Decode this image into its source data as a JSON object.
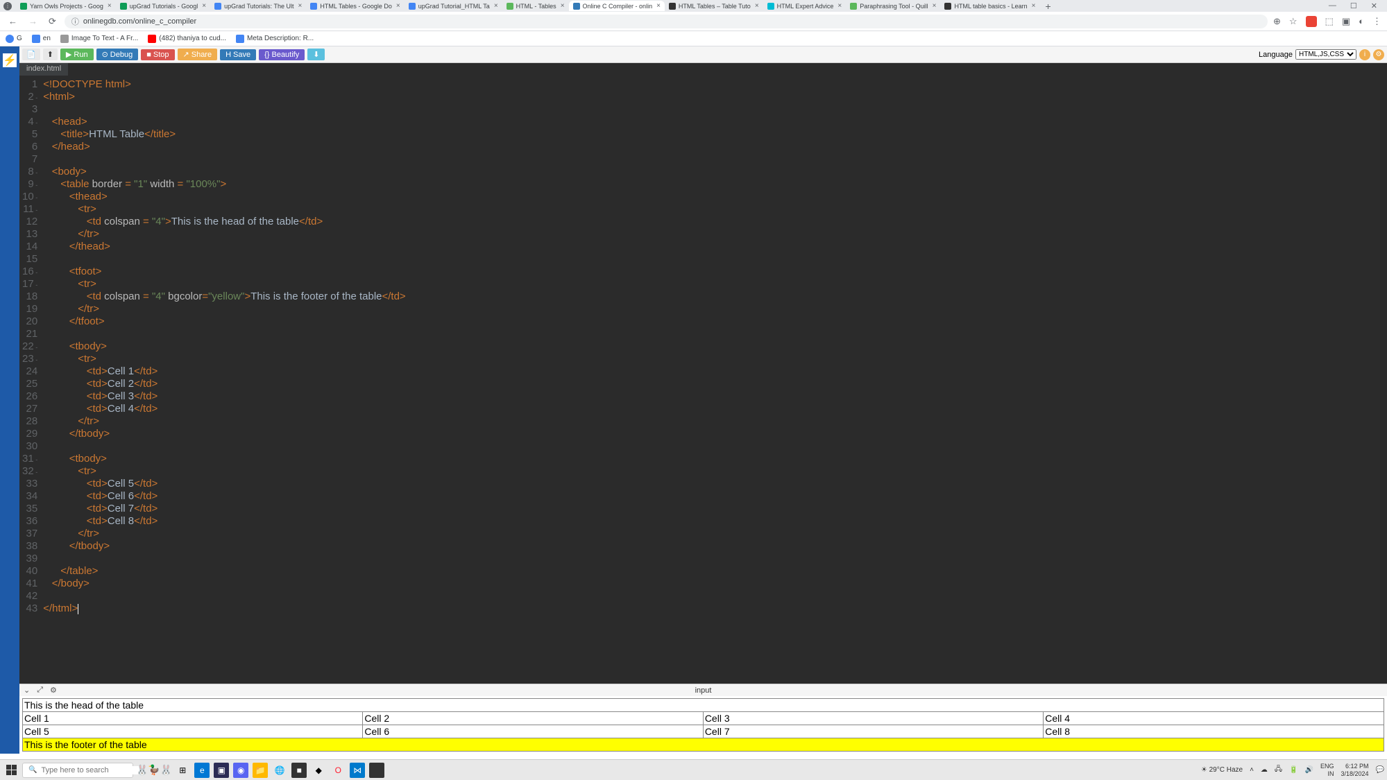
{
  "browser": {
    "tabs": [
      {
        "title": "Yarn Owls Projects - Goog",
        "favcolor": "#0f9d58"
      },
      {
        "title": "upGrad Tutorials - Googl",
        "favcolor": "#0f9d58"
      },
      {
        "title": "upGrad Tutorials: The Ult",
        "favcolor": "#4285f4"
      },
      {
        "title": "HTML Tables - Google Do",
        "favcolor": "#4285f4"
      },
      {
        "title": "upGrad Tutorial_HTML Ta",
        "favcolor": "#4285f4"
      },
      {
        "title": "HTML - Tables",
        "favcolor": "#5cb85c"
      },
      {
        "title": "Online C Compiler - onlin",
        "favcolor": "#337ab7",
        "active": true
      },
      {
        "title": "HTML Tables – Table Tuto",
        "favcolor": "#333"
      },
      {
        "title": "HTML Expert Advice",
        "favcolor": "#00bcd4"
      },
      {
        "title": "Paraphrasing Tool - Quill",
        "favcolor": "#5cb85c"
      },
      {
        "title": "HTML table basics - Learn",
        "favcolor": "#333"
      }
    ],
    "url": "onlinegdb.com/online_c_compiler",
    "bookmarks": [
      {
        "label": "en",
        "icon": "#4285f4"
      },
      {
        "label": "Image To Text - A Fr...",
        "icon": "#999"
      },
      {
        "label": "(482) thaniya to cud...",
        "icon": "#f00"
      },
      {
        "label": "Meta Description: R...",
        "icon": "#4285f4"
      }
    ]
  },
  "ide": {
    "toolbar": {
      "run": "Run",
      "debug": "Debug",
      "stop": "Stop",
      "share": "Share",
      "save": "Save",
      "beautify": "Beautify",
      "lang_label": "Language",
      "lang_value": "HTML,JS,CSS"
    },
    "file_tab": "index.html",
    "output_label": "input"
  },
  "code_lines": [
    {
      "n": 1,
      "html": "<span class='t-tag'>&lt;!DOCTYPE html&gt;</span>"
    },
    {
      "n": 2,
      "fold": true,
      "html": "<span class='t-tag'>&lt;html&gt;</span>"
    },
    {
      "n": 3,
      "html": ""
    },
    {
      "n": 4,
      "fold": true,
      "html": "   <span class='t-tag'>&lt;head&gt;</span>"
    },
    {
      "n": 5,
      "html": "      <span class='t-tag'>&lt;title&gt;</span><span class='t-text'>HTML Table</span><span class='t-tag'>&lt;/title&gt;</span>"
    },
    {
      "n": 6,
      "html": "   <span class='t-tag'>&lt;/head&gt;</span>"
    },
    {
      "n": 7,
      "html": ""
    },
    {
      "n": 8,
      "fold": true,
      "html": "   <span class='t-tag'>&lt;body&gt;</span>"
    },
    {
      "n": 9,
      "fold": true,
      "html": "      <span class='t-tag'>&lt;table</span> <span class='t-attr'>border</span> <span class='t-op'>=</span> <span class='t-str'>\"1\"</span> <span class='t-attr'>width</span> <span class='t-op'>=</span> <span class='t-str'>\"100%\"</span><span class='t-tag'>&gt;</span>"
    },
    {
      "n": 10,
      "fold": true,
      "html": "         <span class='t-tag'>&lt;thead&gt;</span>"
    },
    {
      "n": 11,
      "fold": true,
      "html": "            <span class='t-tag'>&lt;tr&gt;</span>"
    },
    {
      "n": 12,
      "html": "               <span class='t-tag'>&lt;td</span> <span class='t-attr'>colspan</span> <span class='t-op'>=</span> <span class='t-str'>\"4\"</span><span class='t-tag'>&gt;</span><span class='t-text'>This is the head of the table</span><span class='t-tag'>&lt;/td&gt;</span>"
    },
    {
      "n": 13,
      "html": "            <span class='t-tag'>&lt;/tr&gt;</span>"
    },
    {
      "n": 14,
      "html": "         <span class='t-tag'>&lt;/thead&gt;</span>"
    },
    {
      "n": 15,
      "html": ""
    },
    {
      "n": 16,
      "fold": true,
      "html": "         <span class='t-tag'>&lt;tfoot&gt;</span>"
    },
    {
      "n": 17,
      "fold": true,
      "html": "            <span class='t-tag'>&lt;tr&gt;</span>"
    },
    {
      "n": 18,
      "html": "               <span class='t-tag'>&lt;td</span> <span class='t-attr'>colspan</span> <span class='t-op'>=</span> <span class='t-str'>\"4\"</span> <span class='t-attr'>bgcolor</span><span class='t-op'>=</span><span class='t-str'>\"yellow\"</span><span class='t-tag'>&gt;</span><span class='t-text'>This is the footer of the table</span><span class='t-tag'>&lt;/td&gt;</span>"
    },
    {
      "n": 19,
      "html": "            <span class='t-tag'>&lt;/tr&gt;</span>"
    },
    {
      "n": 20,
      "html": "         <span class='t-tag'>&lt;/tfoot&gt;</span>"
    },
    {
      "n": 21,
      "html": ""
    },
    {
      "n": 22,
      "fold": true,
      "html": "         <span class='t-tag'>&lt;tbody&gt;</span>"
    },
    {
      "n": 23,
      "fold": true,
      "html": "            <span class='t-tag'>&lt;tr&gt;</span>"
    },
    {
      "n": 24,
      "html": "               <span class='t-tag'>&lt;td&gt;</span><span class='t-text'>Cell 1</span><span class='t-tag'>&lt;/td&gt;</span>"
    },
    {
      "n": 25,
      "html": "               <span class='t-tag'>&lt;td&gt;</span><span class='t-text'>Cell 2</span><span class='t-tag'>&lt;/td&gt;</span>"
    },
    {
      "n": 26,
      "html": "               <span class='t-tag'>&lt;td&gt;</span><span class='t-text'>Cell 3</span><span class='t-tag'>&lt;/td&gt;</span>"
    },
    {
      "n": 27,
      "html": "               <span class='t-tag'>&lt;td&gt;</span><span class='t-text'>Cell 4</span><span class='t-tag'>&lt;/td&gt;</span>"
    },
    {
      "n": 28,
      "html": "            <span class='t-tag'>&lt;/tr&gt;</span>"
    },
    {
      "n": 29,
      "html": "         <span class='t-tag'>&lt;/tbody&gt;</span>"
    },
    {
      "n": 30,
      "html": ""
    },
    {
      "n": 31,
      "fold": true,
      "html": "         <span class='t-tag'>&lt;tbody&gt;</span>"
    },
    {
      "n": 32,
      "fold": true,
      "html": "            <span class='t-tag'>&lt;tr&gt;</span>"
    },
    {
      "n": 33,
      "html": "               <span class='t-tag'>&lt;td&gt;</span><span class='t-text'>Cell 5</span><span class='t-tag'>&lt;/td&gt;</span>"
    },
    {
      "n": 34,
      "html": "               <span class='t-tag'>&lt;td&gt;</span><span class='t-text'>Cell 6</span><span class='t-tag'>&lt;/td&gt;</span>"
    },
    {
      "n": 35,
      "html": "               <span class='t-tag'>&lt;td&gt;</span><span class='t-text'>Cell 7</span><span class='t-tag'>&lt;/td&gt;</span>"
    },
    {
      "n": 36,
      "html": "               <span class='t-tag'>&lt;td&gt;</span><span class='t-text'>Cell 8</span><span class='t-tag'>&lt;/td&gt;</span>"
    },
    {
      "n": 37,
      "html": "            <span class='t-tag'>&lt;/tr&gt;</span>"
    },
    {
      "n": 38,
      "html": "         <span class='t-tag'>&lt;/tbody&gt;</span>"
    },
    {
      "n": 39,
      "html": ""
    },
    {
      "n": 40,
      "html": "      <span class='t-tag'>&lt;/table&gt;</span>"
    },
    {
      "n": 41,
      "html": "   <span class='t-tag'>&lt;/body&gt;</span>"
    },
    {
      "n": 42,
      "html": ""
    },
    {
      "n": 43,
      "html": "<span class='t-tag'>&lt;/html&gt;</span><span class='cursor'></span>"
    }
  ],
  "output_table": {
    "head": "This is the head of the table",
    "rows": [
      [
        "Cell 1",
        "Cell 2",
        "Cell 3",
        "Cell 4"
      ],
      [
        "Cell 5",
        "Cell 6",
        "Cell 7",
        "Cell 8"
      ]
    ],
    "footer": "This is the footer of the table"
  },
  "taskbar": {
    "search_placeholder": "Type here to search",
    "weather": "29°C  Haze",
    "lang": "ENG\nIN",
    "time": "6:12 PM",
    "date": "3/18/2024"
  }
}
